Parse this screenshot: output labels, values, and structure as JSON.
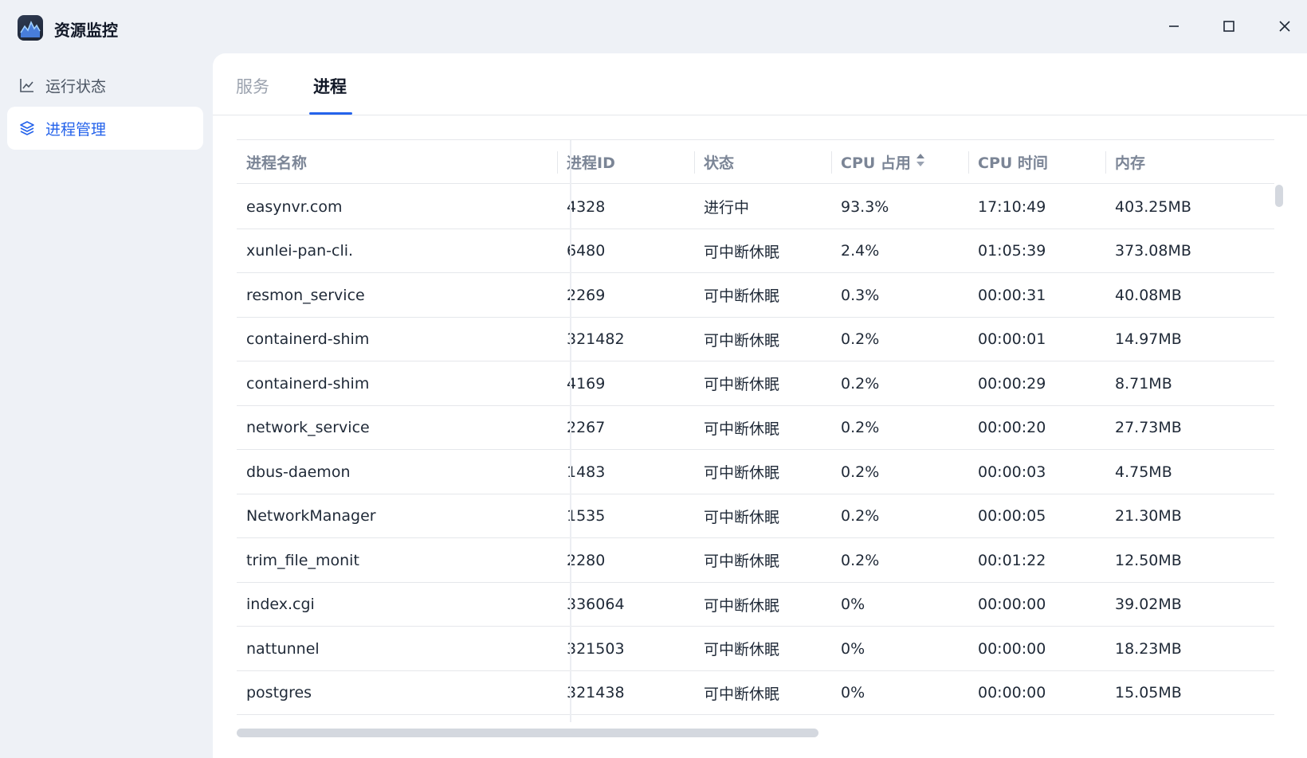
{
  "app": {
    "title": "资源监控",
    "icon": "activity-chart-icon"
  },
  "window_controls": {
    "minimize": "minimize-icon",
    "maximize": "maximize-icon",
    "close": "close-icon"
  },
  "sidebar": {
    "items": [
      {
        "label": "运行状态",
        "icon": "line-chart-icon",
        "active": false
      },
      {
        "label": "进程管理",
        "icon": "layers-icon",
        "active": true
      }
    ]
  },
  "tabs": [
    {
      "label": "服务",
      "active": false
    },
    {
      "label": "进程",
      "active": true
    }
  ],
  "table": {
    "columns": [
      "进程名称",
      "进程ID",
      "状态",
      "CPU 占用",
      "CPU 时间",
      "内存"
    ],
    "sorted_column": "CPU 占用",
    "rows": [
      [
        "easynvr.com",
        "4328",
        "进行中",
        "93.3%",
        "17:10:49",
        "403.25MB"
      ],
      [
        "xunlei-pan-cli.",
        "6480",
        "可中断休眠",
        "2.4%",
        "01:05:39",
        "373.08MB"
      ],
      [
        "resmon_service",
        "2269",
        "可中断休眠",
        "0.3%",
        "00:00:31",
        "40.08MB"
      ],
      [
        "containerd-shim",
        "321482",
        "可中断休眠",
        "0.2%",
        "00:00:01",
        "14.97MB"
      ],
      [
        "containerd-shim",
        "4169",
        "可中断休眠",
        "0.2%",
        "00:00:29",
        "8.71MB"
      ],
      [
        "network_service",
        "2267",
        "可中断休眠",
        "0.2%",
        "00:00:20",
        "27.73MB"
      ],
      [
        "dbus-daemon",
        "1483",
        "可中断休眠",
        "0.2%",
        "00:00:03",
        "4.75MB"
      ],
      [
        "NetworkManager",
        "1535",
        "可中断休眠",
        "0.2%",
        "00:00:05",
        "21.30MB"
      ],
      [
        "trim_file_monit",
        "2280",
        "可中断休眠",
        "0.2%",
        "00:01:22",
        "12.50MB"
      ],
      [
        "index.cgi",
        "336064",
        "可中断休眠",
        "0%",
        "00:00:00",
        "39.02MB"
      ],
      [
        "nattunnel",
        "321503",
        "可中断休眠",
        "0%",
        "00:00:00",
        "18.23MB"
      ],
      [
        "postgres",
        "321438",
        "可中断休眠",
        "0%",
        "00:00:00",
        "15.05MB"
      ]
    ]
  },
  "colors": {
    "accent": "#2563eb",
    "background": "#eef1f6",
    "panel": "#ffffff",
    "header_text": "#7b8596"
  }
}
